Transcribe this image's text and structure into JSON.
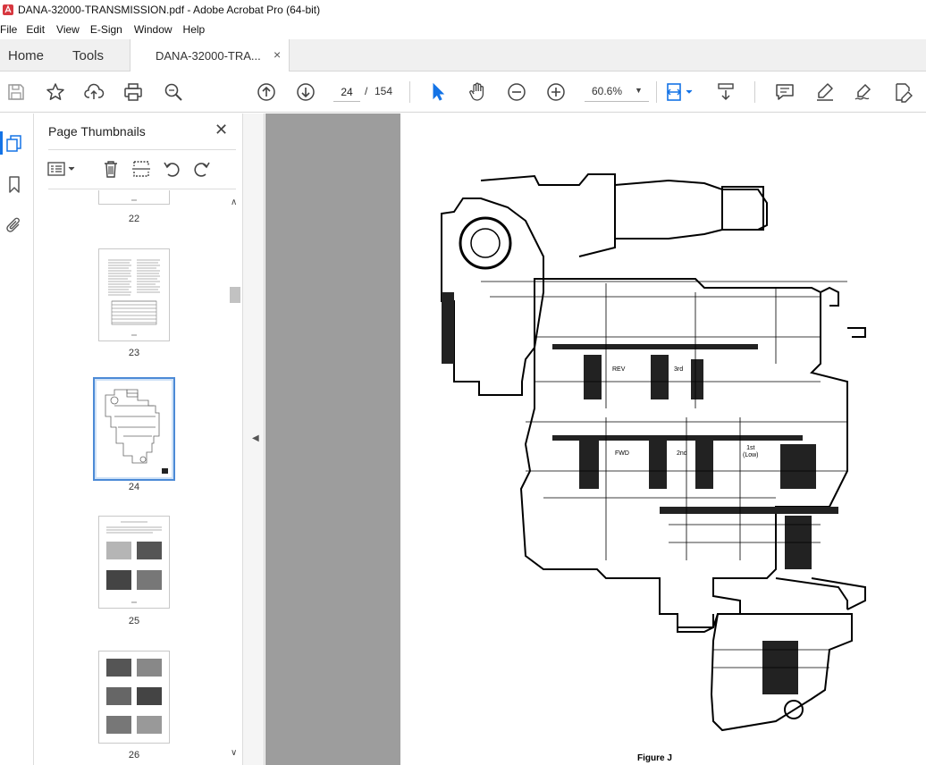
{
  "window": {
    "title": "DANA-32000-TRANSMISSION.pdf - Adobe Acrobat Pro (64-bit)"
  },
  "menu": {
    "items": [
      "File",
      "Edit",
      "View",
      "E-Sign",
      "Window",
      "Help"
    ]
  },
  "tabs": {
    "home": "Home",
    "tools": "Tools",
    "document": "DANA-32000-TRA...",
    "close_glyph": "×"
  },
  "toolbar": {
    "current_page": "24",
    "page_separator": "/",
    "total_pages": "154",
    "zoom": "60.6%"
  },
  "panel": {
    "title": "Page Thumbnails",
    "close_glyph": "✕"
  },
  "thumbnails": [
    {
      "label": "22",
      "selected": false
    },
    {
      "label": "23",
      "selected": false
    },
    {
      "label": "24",
      "selected": true
    },
    {
      "label": "25",
      "selected": false
    },
    {
      "label": "26",
      "selected": false
    }
  ],
  "document": {
    "figure_caption": "Figure J",
    "gear_labels": {
      "rev": "REV",
      "third": "3rd",
      "fwd": "FWD",
      "second": "2nd",
      "first": "1st\n(Low)"
    }
  },
  "colors": {
    "accent": "#1473e6",
    "doc_background": "#9d9d9d",
    "acrobat_red": "#d7373f"
  }
}
